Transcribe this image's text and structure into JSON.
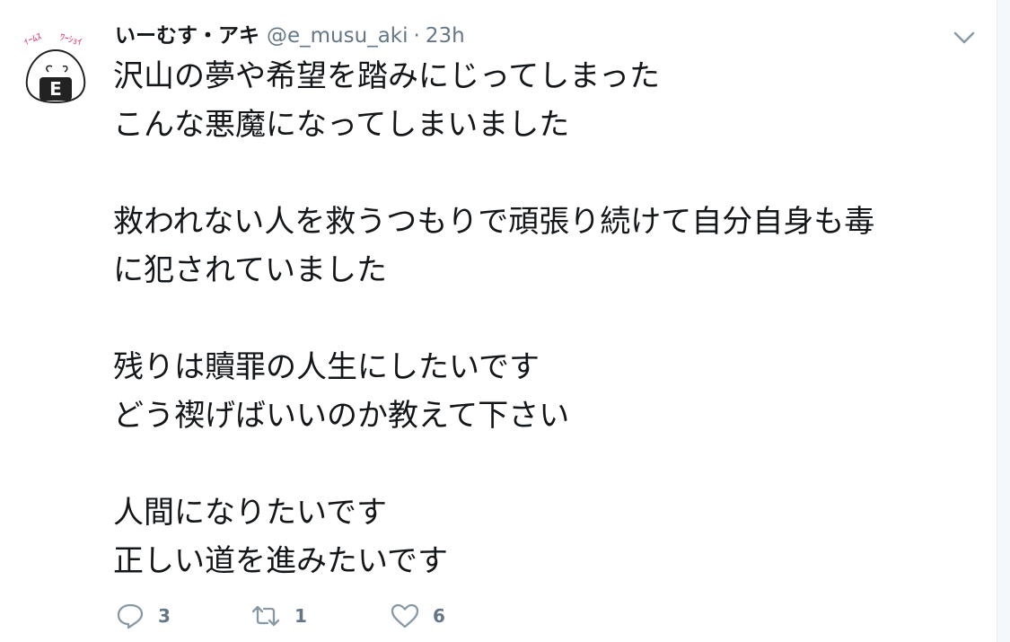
{
  "tweet": {
    "display_name": "いーむす・アキ",
    "handle": "@e_musu_aki",
    "separator": "·",
    "time": "23h",
    "avatar_icon": "onigiri-e-avatar",
    "lines": [
      "沢山の夢や希望を踏みにじってしまった",
      "こんな悪魔になってしまいました",
      "",
      "救われない人を救うつもりで頑張り続けて自分自身も毒",
      "に犯されていました",
      "",
      "残りは贖罪の人生にしたいです",
      "どう禊げばいいのか教えて下さい",
      "",
      "人間になりたいです",
      "正しい道を進みたいです"
    ],
    "actions": {
      "reply_count": "3",
      "retweet_count": "1",
      "like_count": "6"
    }
  },
  "colors": {
    "text": "#14171a",
    "secondary": "#657786",
    "icon": "#8899a6",
    "border": "#e6ecf0"
  },
  "icons": [
    "chevron-down-icon",
    "reply-icon",
    "retweet-icon",
    "heart-icon"
  ]
}
